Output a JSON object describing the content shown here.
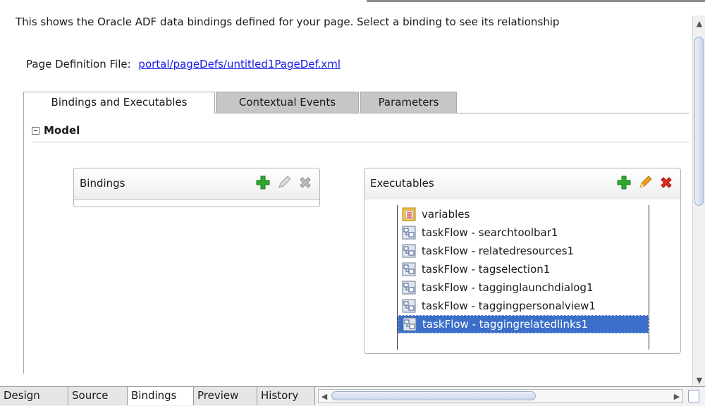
{
  "intro": "This shows the Oracle ADF data bindings defined for your page. Select a binding to see its relationship",
  "page_def": {
    "label": "Page Definition File:",
    "link": "portal/pageDefs/untitled1PageDef.xml"
  },
  "tabs": [
    {
      "label": "Bindings and Executables",
      "active": true
    },
    {
      "label": "Contextual Events",
      "active": false
    },
    {
      "label": "Parameters",
      "active": false
    }
  ],
  "model": {
    "label": "Model"
  },
  "bindings_panel": {
    "title": "Bindings",
    "tools": [
      "add-icon",
      "edit-icon",
      "delete-icon"
    ],
    "enabled": [
      true,
      false,
      false
    ]
  },
  "executables_panel": {
    "title": "Executables",
    "tools": [
      "add-icon",
      "edit-icon",
      "delete-icon"
    ],
    "items": [
      {
        "label": "variables",
        "icon": "variables-icon"
      },
      {
        "label": "taskFlow - searchtoolbar1",
        "icon": "taskflow-icon"
      },
      {
        "label": "taskFlow - relatedresources1",
        "icon": "taskflow-icon"
      },
      {
        "label": "taskFlow - tagselection1",
        "icon": "taskflow-icon"
      },
      {
        "label": "taskFlow - tagginglaunchdialog1",
        "icon": "taskflow-icon"
      },
      {
        "label": "taskFlow - taggingpersonalview1",
        "icon": "taskflow-icon"
      },
      {
        "label": "taskFlow - taggingrelatedlinks1",
        "icon": "taskflow-icon",
        "selected": true
      }
    ]
  },
  "bottom_tabs": [
    {
      "label": "Design",
      "active": false
    },
    {
      "label": "Source",
      "active": false
    },
    {
      "label": "Bindings",
      "active": true
    },
    {
      "label": "Preview",
      "active": false
    },
    {
      "label": "History",
      "active": false
    }
  ],
  "colors": {
    "selection": "#3b6fca",
    "link": "#1a1ae6",
    "add_green": "#2fa82f",
    "delete_red": "#e02a1a",
    "edit_orange": "#e8a21a"
  }
}
